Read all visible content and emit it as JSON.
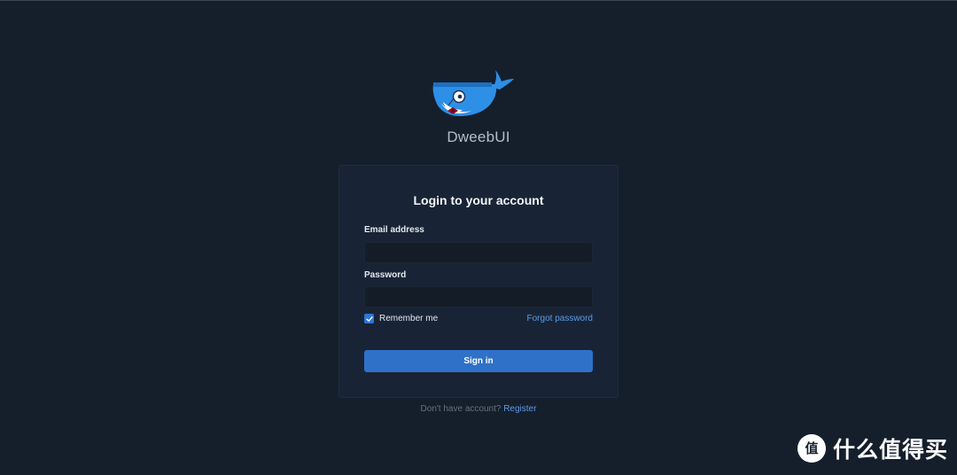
{
  "app": {
    "brand_name": "DweebUI"
  },
  "login": {
    "title": "Login to your account",
    "email_label": "Email address",
    "email_value": "",
    "email_placeholder": "",
    "password_label": "Password",
    "password_value": "",
    "password_placeholder": "",
    "remember_label": "Remember me",
    "remember_checked": true,
    "forgot_label": "Forgot password",
    "signin_label": "Sign in"
  },
  "footer": {
    "prompt": "Don't have account?",
    "register_label": "Register"
  },
  "watermark": {
    "text": "什么值得买",
    "icon": "zhi-icon"
  },
  "colors": {
    "background": "#151f2c",
    "card": "#182436",
    "accent": "#2f71c9",
    "link": "#5c9be6"
  }
}
